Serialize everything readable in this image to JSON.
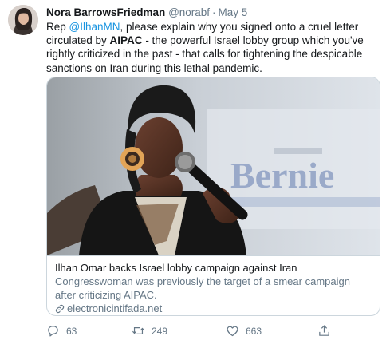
{
  "tweet": {
    "display_name": "Nora BarrowsFriedman",
    "handle": "@norabf",
    "separator": "·",
    "date": "May 5",
    "text": {
      "part1": "Rep ",
      "mention": "@IlhanMN",
      "part2": ", please explain why you signed onto a cruel letter circulated by ",
      "org": "AIPAC",
      "part3": " - the powerful Israel lobby group which you've rightly criticized in the past - that calls for tightening the despicable sanctions on Iran during this lethal pandemic."
    },
    "card": {
      "image_text": "Bernie",
      "title": "Ilhan Omar backs Israel lobby campaign against Iran",
      "description": "Congresswoman was previously the target of a smear campaign after criticizing AIPAC.",
      "domain": "electronicintifada.net"
    },
    "actions": {
      "replies": "63",
      "retweets": "249",
      "likes": "663"
    }
  },
  "icons": {
    "reply": "reply-icon",
    "retweet": "retweet-icon",
    "like": "heart-icon",
    "share": "share-icon",
    "link": "link-icon"
  },
  "colors": {
    "link_blue": "#1b95e0",
    "secondary_text": "#657786",
    "border": "#ccd6dd"
  }
}
